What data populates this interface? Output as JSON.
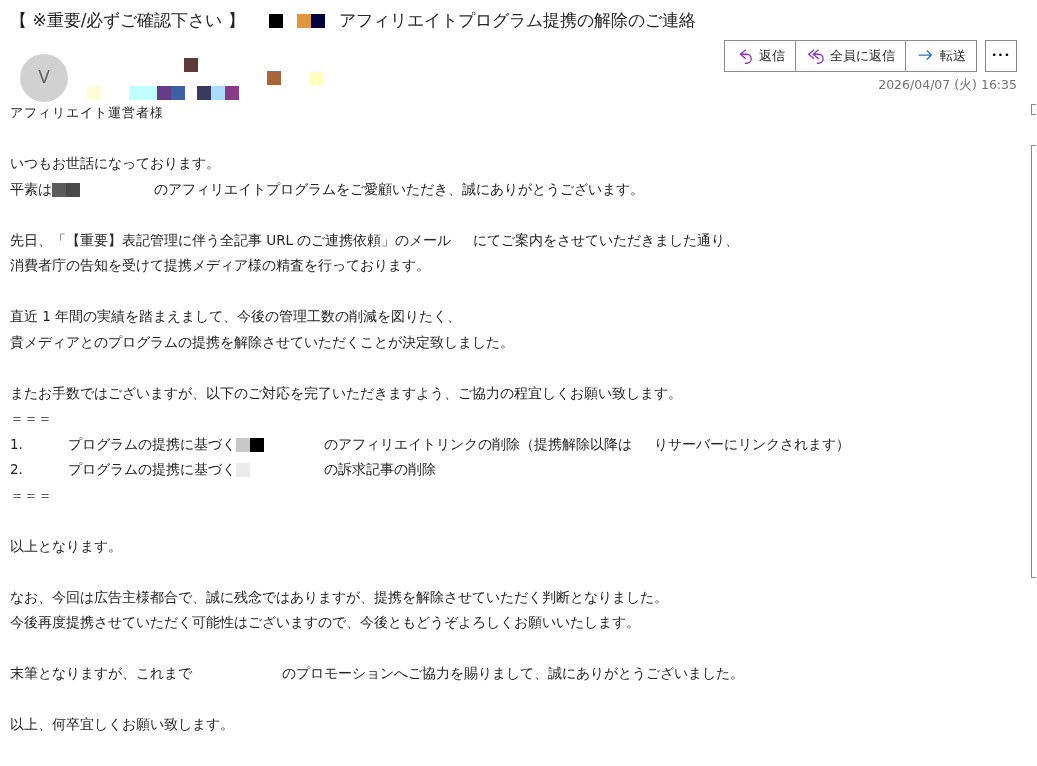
{
  "subject": [
    {
      "kind": "text",
      "text": "【 ※重要/必ずご確認下さい 】"
    },
    {
      "kind": "redact",
      "marks": [
        {
          "color": "#000000"
        }
      ]
    },
    {
      "kind": "redact",
      "marks": [
        {
          "color": "#e0963c"
        },
        {
          "color": "#00003c"
        }
      ]
    },
    {
      "kind": "text",
      "text": "アフィリエイトプログラム提携の解除のご連絡"
    }
  ],
  "sender": {
    "avatar": "V",
    "redactions": [
      {
        "color": "#5f3838"
      },
      {
        "color": "#fffcd8"
      },
      {
        "color": "#c0ffff"
      },
      {
        "color": "#c0ffff"
      },
      {
        "color": "#663c88"
      },
      {
        "color": "#3d5fa6"
      },
      {
        "color": "#3a3a5e"
      },
      {
        "color": "#a8dcfa"
      },
      {
        "color": "#8a3a8a"
      },
      {
        "color": "#a8643a"
      },
      {
        "color": "#ffffc0"
      }
    ]
  },
  "actions": [
    {
      "kind": "reply",
      "label": "返信"
    },
    {
      "kind": "reply_all",
      "label": "全員に返信"
    },
    {
      "kind": "forward",
      "label": "転送"
    }
  ],
  "more": "•••",
  "date": "2026/04/07 (火) 16:35",
  "salutation": "アフィリエイト運営者様",
  "body": [
    {
      "lines": [
        {
          "parts": [
            {
              "kind": "text",
              "text": "いつもお世話になっております。"
            }
          ]
        },
        {
          "parts": [
            {
              "kind": "text",
              "text": "平素は"
            },
            {
              "kind": "redact",
              "marks": [
                {
                  "color": "#5c5c5c"
                },
                {
                  "color": "#4a4a4a"
                }
              ]
            },
            {
              "kind": "widegap"
            },
            {
              "kind": "text",
              "text": "のアフィリエイトプログラムをご愛顧いただき、誠にありがとうございます。"
            }
          ]
        }
      ]
    },
    {
      "lines": [
        {
          "parts": [
            {
              "kind": "text",
              "text": "先日、「【重要】表記管理に伴う全記事 URL のご連携依頼」のメール"
            },
            {
              "kind": "gap"
            },
            {
              "kind": "text",
              "text": "にてご案内をさせていただきました通り、"
            }
          ]
        },
        {
          "parts": [
            {
              "kind": "text",
              "text": "消費者庁の告知を受けて提携メディア様の精査を行っております。"
            }
          ]
        }
      ]
    },
    {
      "lines": [
        {
          "parts": [
            {
              "kind": "text",
              "text": "直近 1 年間の実績を踏まえまして、今後の管理工数の削減を図りたく、"
            }
          ]
        },
        {
          "parts": [
            {
              "kind": "text",
              "text": "貴メディアとのプログラムの提携を解除させていただくことが決定致しました。"
            }
          ]
        }
      ]
    },
    {
      "lines": [
        {
          "parts": [
            {
              "kind": "text",
              "text": "またお手数ではございますが、以下のご対応を完了いただきますよう、ご協力の程宜しくお願い致します。"
            }
          ]
        },
        {
          "parts": [
            {
              "kind": "text",
              "text": "＝＝＝"
            }
          ]
        },
        {
          "parts": [
            {
              "kind": "number",
              "text": "1."
            },
            {
              "kind": "text",
              "text": "プログラムの提携に基づく"
            },
            {
              "kind": "redact",
              "marks": [
                {
                  "color": "#c8c8c8"
                },
                {
                  "color": "#000000"
                }
              ]
            },
            {
              "kind": "midgap"
            },
            {
              "kind": "text",
              "text": "のアフィリエイトリンクの削除（提携解除以降は"
            },
            {
              "kind": "gap"
            },
            {
              "kind": "text",
              "text": "りサーバーにリンクされます）"
            }
          ]
        },
        {
          "parts": [
            {
              "kind": "number",
              "text": "2."
            },
            {
              "kind": "text",
              "text": "プログラムの提携に基づく"
            },
            {
              "kind": "redact",
              "marks": [
                {
                  "color": "#ebebeb"
                }
              ]
            },
            {
              "kind": "widegap"
            },
            {
              "kind": "text",
              "text": "の訴求記事の削除"
            }
          ]
        },
        {
          "parts": [
            {
              "kind": "text",
              "text": "＝＝＝"
            }
          ]
        }
      ]
    },
    {
      "lines": [
        {
          "parts": [
            {
              "kind": "text",
              "text": "以上となります。"
            }
          ]
        }
      ]
    },
    {
      "lines": [
        {
          "parts": [
            {
              "kind": "text",
              "text": "なお、今回は広告主様都合で、誠に残念ではありますが、提携を解除させていただく判断となりました。"
            }
          ]
        },
        {
          "parts": [
            {
              "kind": "text",
              "text": "今後再度提携させていただく可能性はございますので、今後ともどうぞよろしくお願いいたします。"
            }
          ]
        }
      ]
    },
    {
      "lines": [
        {
          "parts": [
            {
              "kind": "text",
              "text": "末筆となりますが、これまで"
            },
            {
              "kind": "widestgap"
            },
            {
              "kind": "text",
              "text": "のプロモーションへご協力を賜りまして、誠にありがとうございました。"
            }
          ]
        }
      ]
    },
    {
      "lines": [
        {
          "parts": [
            {
              "kind": "text",
              "text": "以上、何卒宜しくお願い致します。"
            }
          ]
        }
      ]
    }
  ]
}
